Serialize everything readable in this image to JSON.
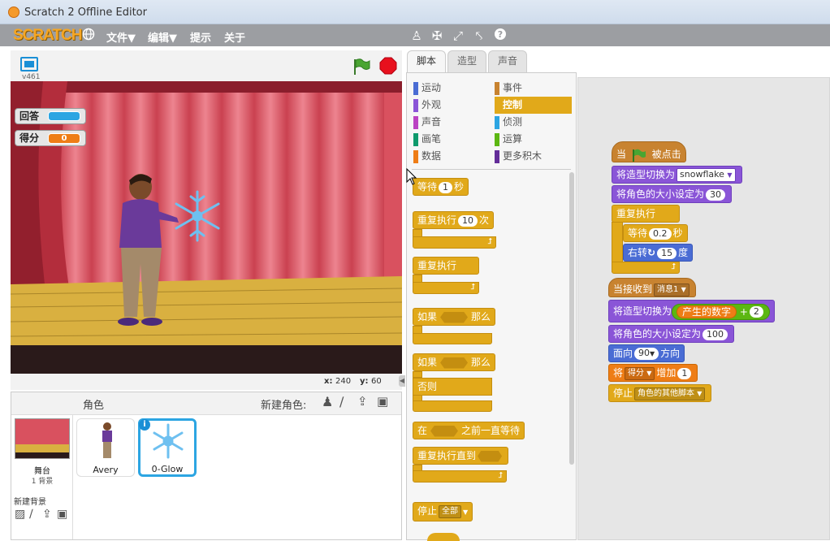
{
  "window": {
    "title": "Scratch 2 Offline Editor"
  },
  "menu": {
    "logo": "SCRATCH",
    "file": "文件▼",
    "edit": "编辑▼",
    "tips": "提示",
    "about": "关于"
  },
  "stage": {
    "version": "v461",
    "x_label": "x:",
    "x_value": "240",
    "y_label": "y:",
    "y_value": "60",
    "monitors": [
      {
        "label": "回答",
        "value": ""
      },
      {
        "label": "得分",
        "value": "0"
      }
    ]
  },
  "sprites": {
    "header": "角色",
    "new_sprite": "新建角色:",
    "stage_name": "舞台",
    "stage_backdrops": "1 背景",
    "new_backdrop": "新建背景",
    "list": [
      {
        "name": "Avery",
        "selected": false
      },
      {
        "name": "0-Glow",
        "selected": true
      }
    ]
  },
  "tabs": [
    "脚本",
    "造型",
    "声音"
  ],
  "categories": {
    "left": [
      "运动",
      "外观",
      "声音",
      "画笔",
      "数据"
    ],
    "right": [
      "事件",
      "控制",
      "侦测",
      "运算",
      "更多积木"
    ],
    "colors_left": [
      "#4a6cd4",
      "#8a55d7",
      "#bb42c3",
      "#0e9a6c",
      "#ee7d16"
    ],
    "colors_right": [
      "#c88330",
      "#e1a91a",
      "#2ca5e2",
      "#5cb712",
      "#632d99"
    ],
    "active": "控制"
  },
  "palette": {
    "wait": "等待",
    "wait_val": "1",
    "wait_unit": "秒",
    "repeat": "重复执行",
    "repeat_val": "10",
    "repeat_unit": "次",
    "forever": "重复执行",
    "if": "如果",
    "then": "那么",
    "if2": "如果",
    "then2": "那么",
    "else": "否则",
    "wait_until_a": "在",
    "wait_until_b": "之前一直等待",
    "repeat_until": "重复执行直到",
    "stop": "停止",
    "stop_val": "全部"
  },
  "script": {
    "hat_a": "当",
    "hat_b": "被点击",
    "switch_costume": "将造型切换为",
    "costume_val": "snowflake",
    "set_size": "将角色的大小设定为",
    "size_val": "30",
    "forever": "重复执行",
    "wait": "等待",
    "wait_val": "0.2",
    "wait_unit": "秒",
    "turn": "右转",
    "turn_val": "15",
    "turn_unit": "度",
    "receive": "当接收到",
    "receive_val": "消息1",
    "switch2": "将造型切换为",
    "random": "产生的数字",
    "plus": "+",
    "plus_val": "2",
    "set_size2": "将角色的大小设定为",
    "size_val2": "100",
    "point": "面向",
    "point_val": "90",
    "point_unit": "方向",
    "change_a": "将",
    "change_var": "得分",
    "change_b": "增加",
    "change_val": "1",
    "stop": "停止",
    "stop_val": "角色的其他脚本"
  }
}
